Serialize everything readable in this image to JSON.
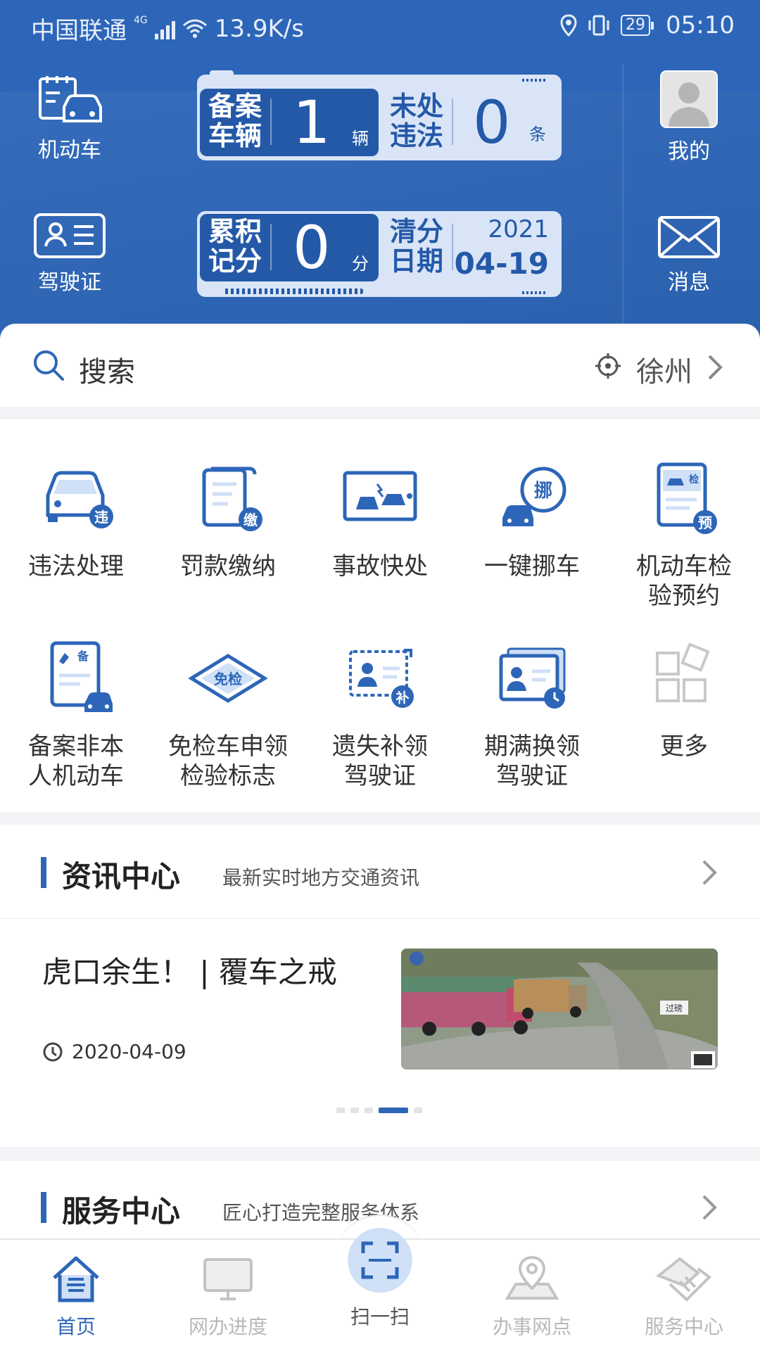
{
  "status_bar": {
    "carrier": "中国联通",
    "network": "4G",
    "speed": "13.9K/s",
    "battery": "29",
    "time": "05:10"
  },
  "header": {
    "vehicle_label": "机动车",
    "license_label": "驾驶证",
    "mine_label": "我的",
    "message_label": "消息",
    "card1": {
      "left_caption": "备案车辆",
      "left_value": "1",
      "left_unit": "辆",
      "right_caption": "未处违法",
      "right_value": "0",
      "right_unit": "条"
    },
    "card2": {
      "left_caption": "累积记分",
      "left_value": "0",
      "left_unit": "分",
      "right_caption": "清分日期",
      "right_year": "2021",
      "right_date": "04-19"
    }
  },
  "search": {
    "placeholder": "搜索",
    "city": "徐州"
  },
  "services": [
    {
      "label": "违法处理",
      "icon": "car-violation-icon"
    },
    {
      "label": "罚款缴纳",
      "icon": "fine-payment-icon"
    },
    {
      "label": "事故快处",
      "icon": "accident-icon"
    },
    {
      "label": "一键挪车",
      "icon": "move-car-icon"
    },
    {
      "label": "机动车检验预约",
      "icon": "inspection-booking-icon"
    },
    {
      "label": "备案非本人机动车",
      "icon": "register-vehicle-icon"
    },
    {
      "label": "免检车申领检验标志",
      "icon": "exempt-sign-icon"
    },
    {
      "label": "遗失补领驾驶证",
      "icon": "replace-license-icon"
    },
    {
      "label": "期满换领驾驶证",
      "icon": "renew-license-icon"
    },
    {
      "label": "更多",
      "icon": "more-icon"
    }
  ],
  "news": {
    "title": "资讯中心",
    "subtitle": "最新实时地方交通资讯",
    "headline": "虎口余生！ | 覆车之戒",
    "date": "2020-04-09",
    "thumb_sign": "过磅"
  },
  "service_center": {
    "title": "服务中心",
    "subtitle": "匠心打造完整服务体系"
  },
  "bottom_nav": [
    {
      "label": "首页",
      "icon": "home-icon",
      "active": true
    },
    {
      "label": "网办进度",
      "icon": "monitor-icon",
      "active": false
    },
    {
      "label": "扫一扫",
      "icon": "scan-icon",
      "active": false
    },
    {
      "label": "办事网点",
      "icon": "location-pin-icon",
      "active": false
    },
    {
      "label": "服务中心",
      "icon": "handshake-icon",
      "active": false
    }
  ],
  "colors": {
    "primary": "#2d66b8",
    "card_dark": "#2459a8",
    "card_light": "#d9e5f7",
    "inactive": "#b9b9b9"
  }
}
